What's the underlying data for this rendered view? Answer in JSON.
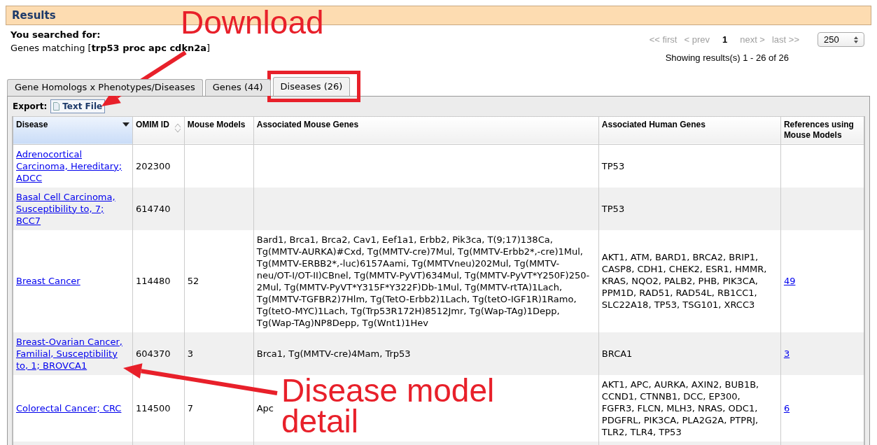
{
  "header": {
    "title": "Results"
  },
  "search": {
    "label": "You searched for:",
    "summary": "Genes matching [**trp53 proc apc cdkn2a**]"
  },
  "pagination": {
    "links": [
      {
        "label": "<< first",
        "disabled": true
      },
      {
        "label": "< prev",
        "disabled": true
      },
      {
        "label": "1",
        "selected": true
      },
      {
        "label": "next >",
        "disabled": true
      },
      {
        "label": "last >>",
        "disabled": true
      }
    ],
    "per_page": "250",
    "results": "Showing results(s) 1 - 26 of 26"
  },
  "tabs": [
    {
      "label": "Gene Homologs x Phenotypes/Diseases",
      "selected": false
    },
    {
      "label": "Genes (44)",
      "selected": false
    },
    {
      "label": "Diseases (26)",
      "selected": true
    }
  ],
  "export": {
    "label": "Export:",
    "button": "Text File"
  },
  "table": {
    "columns": [
      {
        "label": "Disease",
        "sorted": true,
        "sortable": true
      },
      {
        "label": "OMIM ID",
        "sorted": false,
        "sortable": true
      },
      {
        "label": "Mouse Models",
        "sorted": false,
        "sortable": false
      },
      {
        "label": "Associated Mouse Genes",
        "sorted": false,
        "sortable": false
      },
      {
        "label": "Associated Human Genes",
        "sorted": false,
        "sortable": false
      },
      {
        "label": "References using Mouse Models",
        "sorted": false,
        "sortable": false
      }
    ],
    "rows": [
      {
        "disease": "Adrenocortical Carcinoma, Hereditary; ADCC",
        "omim": "202300",
        "models": "",
        "mouse_genes": "",
        "human_genes": "TP53",
        "references": ""
      },
      {
        "disease": "Basal Cell Carcinoma, Susceptibility to, 7; BCC7",
        "omim": "614740",
        "models": "",
        "mouse_genes": "",
        "human_genes": "TP53",
        "references": ""
      },
      {
        "disease": "Breast Cancer",
        "omim": "114480",
        "models": "52",
        "mouse_genes": "Bard1, Brca1, Brca2, Cav1, Eef1a1, Erbb2, Pik3ca, T(9;17)138Ca, Tg(MMTV-AURKA)#Cxd, Tg(MMTV-cre)7Mul, Tg(MMTV-Erbb2*,-cre)1Mul, Tg(MMTV-ERBB2*,-luc)6157Aami, Tg(MMTVneu)202Mul, Tg(MMTV-neu/OT-I/OT-II)CBnel, Tg(MMTV-PyVT)634Mul, Tg(MMTV-PyVT*Y250F)250-2Mul, Tg(MMTV-PyVT*Y315F*Y322F)Db-1Mul, Tg(MMTV-rtTA)1Lach, Tg(MMTV-TGFBR2)7Hlm, Tg(TetO-Erbb2)1Lach, Tg(tetO-IGF1R)1Ramo, Tg(tetO-MYC)1Lach, Tg(Trp53R172H)8512Jmr, Tg(Wap-TAg)1Depp, Tg(Wap-TAg)NP8Depp, Tg(Wnt1)1Hev",
        "human_genes": "AKT1, ATM, BARD1, BRCA2, BRIP1, CASP8, CDH1, CHEK2, ESR1, HMMR, KRAS, NQO2, PALB2, PHB, PIK3CA, PPM1D, RAD51, RAD54L, RB1CC1, SLC22A18, TP53, TSG101, XRCC3",
        "references": "49"
      },
      {
        "disease": "Breast-Ovarian Cancer, Familial, Susceptibility to, 1; BROVCA1",
        "omim": "604370",
        "models": "3",
        "mouse_genes": "Brca1, Tg(MMTV-cre)4Mam, Trp53",
        "human_genes": "BRCA1",
        "references": "3"
      },
      {
        "disease": "Colorectal Cancer; CRC",
        "omim": "114500",
        "models": "7",
        "mouse_genes": "Apc",
        "human_genes": "AKT1, APC, AURKA, AXIN2, BUB1B, CCND1, CTNNB1, DCC, EP300, FGFR3, FLCN, MLH3, NRAS, ODC1, PDGFRL, PIK3CA, PLA2G2A, PTPRJ, TLR2, TLR4, TP53",
        "references": "6"
      }
    ]
  },
  "annotations": [
    {
      "kind": "label",
      "text": "Download"
    },
    {
      "kind": "arrow"
    },
    {
      "kind": "box"
    },
    {
      "kind": "label",
      "text": "Disease model detail"
    },
    {
      "kind": "arrow"
    }
  ]
}
